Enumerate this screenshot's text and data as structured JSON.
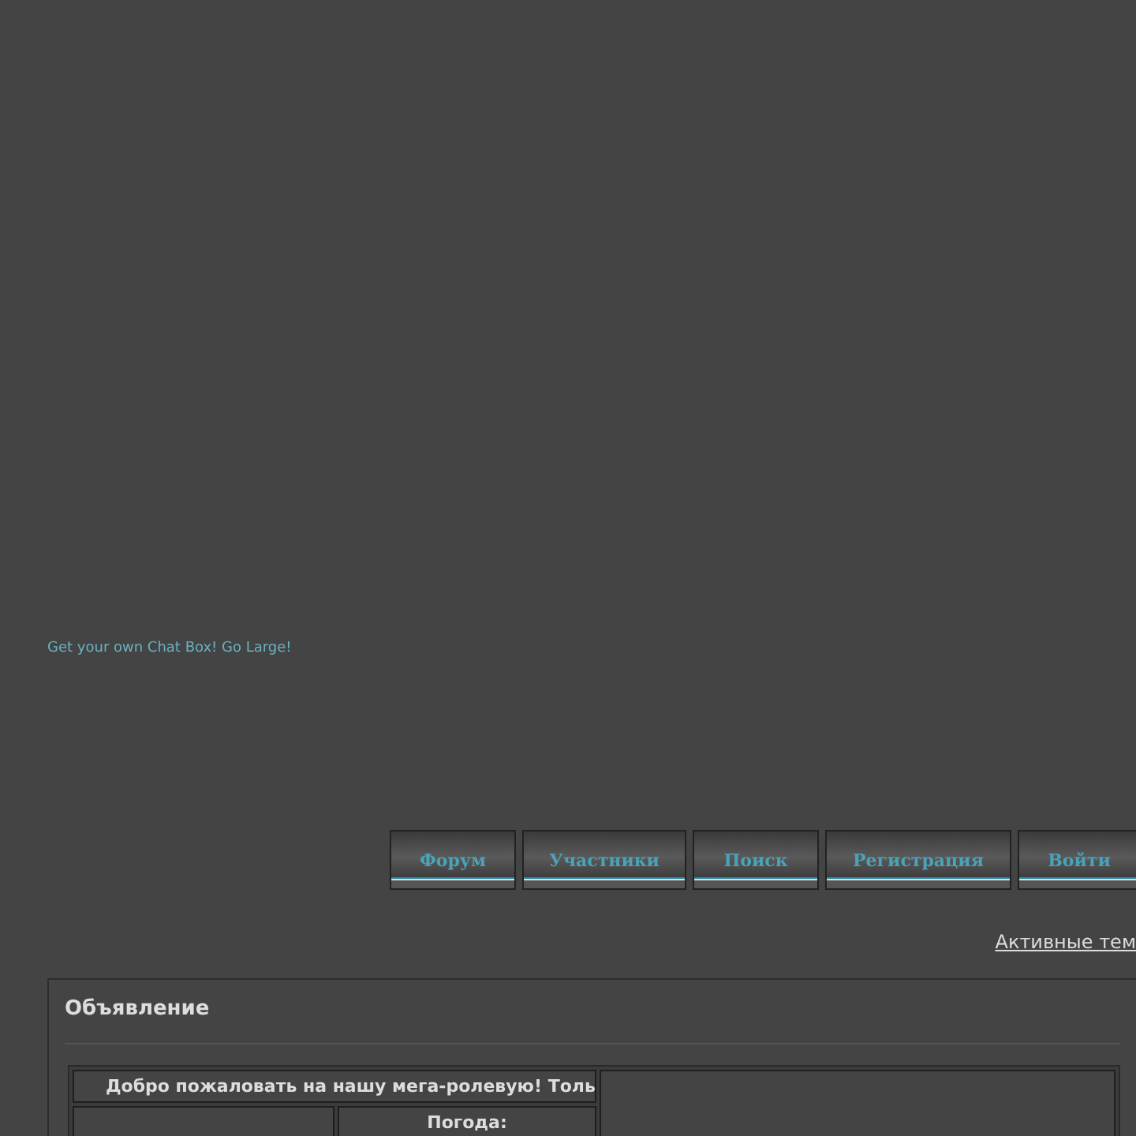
{
  "chat_box": {
    "link": "Get your own Chat Box! Go Large!"
  },
  "nav": [
    {
      "label": "Форум"
    },
    {
      "label": "Участники"
    },
    {
      "label": "Поиск"
    },
    {
      "label": "Регистрация"
    },
    {
      "label": "Войти"
    }
  ],
  "active_topics_link": "Активные тем",
  "announcement": {
    "title": "Объявление",
    "welcome": "Добро пожаловать на нашу мега-ролевую! Толь",
    "weather_label": "Погода:"
  }
}
